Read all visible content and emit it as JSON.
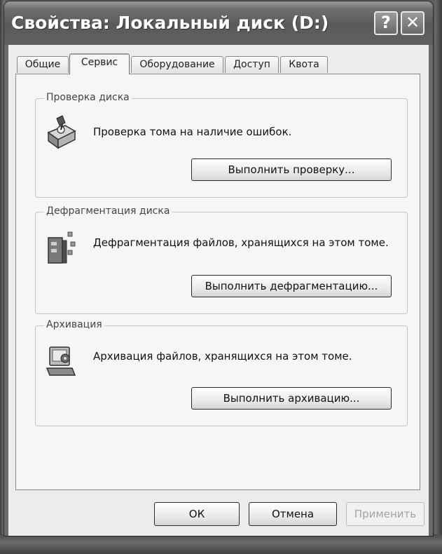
{
  "window": {
    "title": "Свойства: Локальный диск (D:)",
    "help_glyph": "?",
    "close_glyph": "✕"
  },
  "tabs": [
    {
      "label": "Общие",
      "active": false
    },
    {
      "label": "Сервис",
      "active": true
    },
    {
      "label": "Оборудование",
      "active": false
    },
    {
      "label": "Доступ",
      "active": false
    },
    {
      "label": "Квота",
      "active": false
    }
  ],
  "groups": {
    "check": {
      "title": "Проверка диска",
      "description": "Проверка тома на наличие ошибок.",
      "button": "Выполнить проверку...",
      "icon": "disk-check-icon"
    },
    "defrag": {
      "title": "Дефрагментация диска",
      "description": "Дефрагментация файлов, хранящихся на этом томе.",
      "button": "Выполнить дефрагментацию...",
      "icon": "defragment-icon"
    },
    "backup": {
      "title": "Архивация",
      "description": "Архивация файлов, хранящихся на этом томе.",
      "button": "Выполнить архивацию...",
      "icon": "backup-icon"
    }
  },
  "footer": {
    "ok": "ОК",
    "cancel": "Отмена",
    "apply": "Применить",
    "apply_enabled": false
  }
}
